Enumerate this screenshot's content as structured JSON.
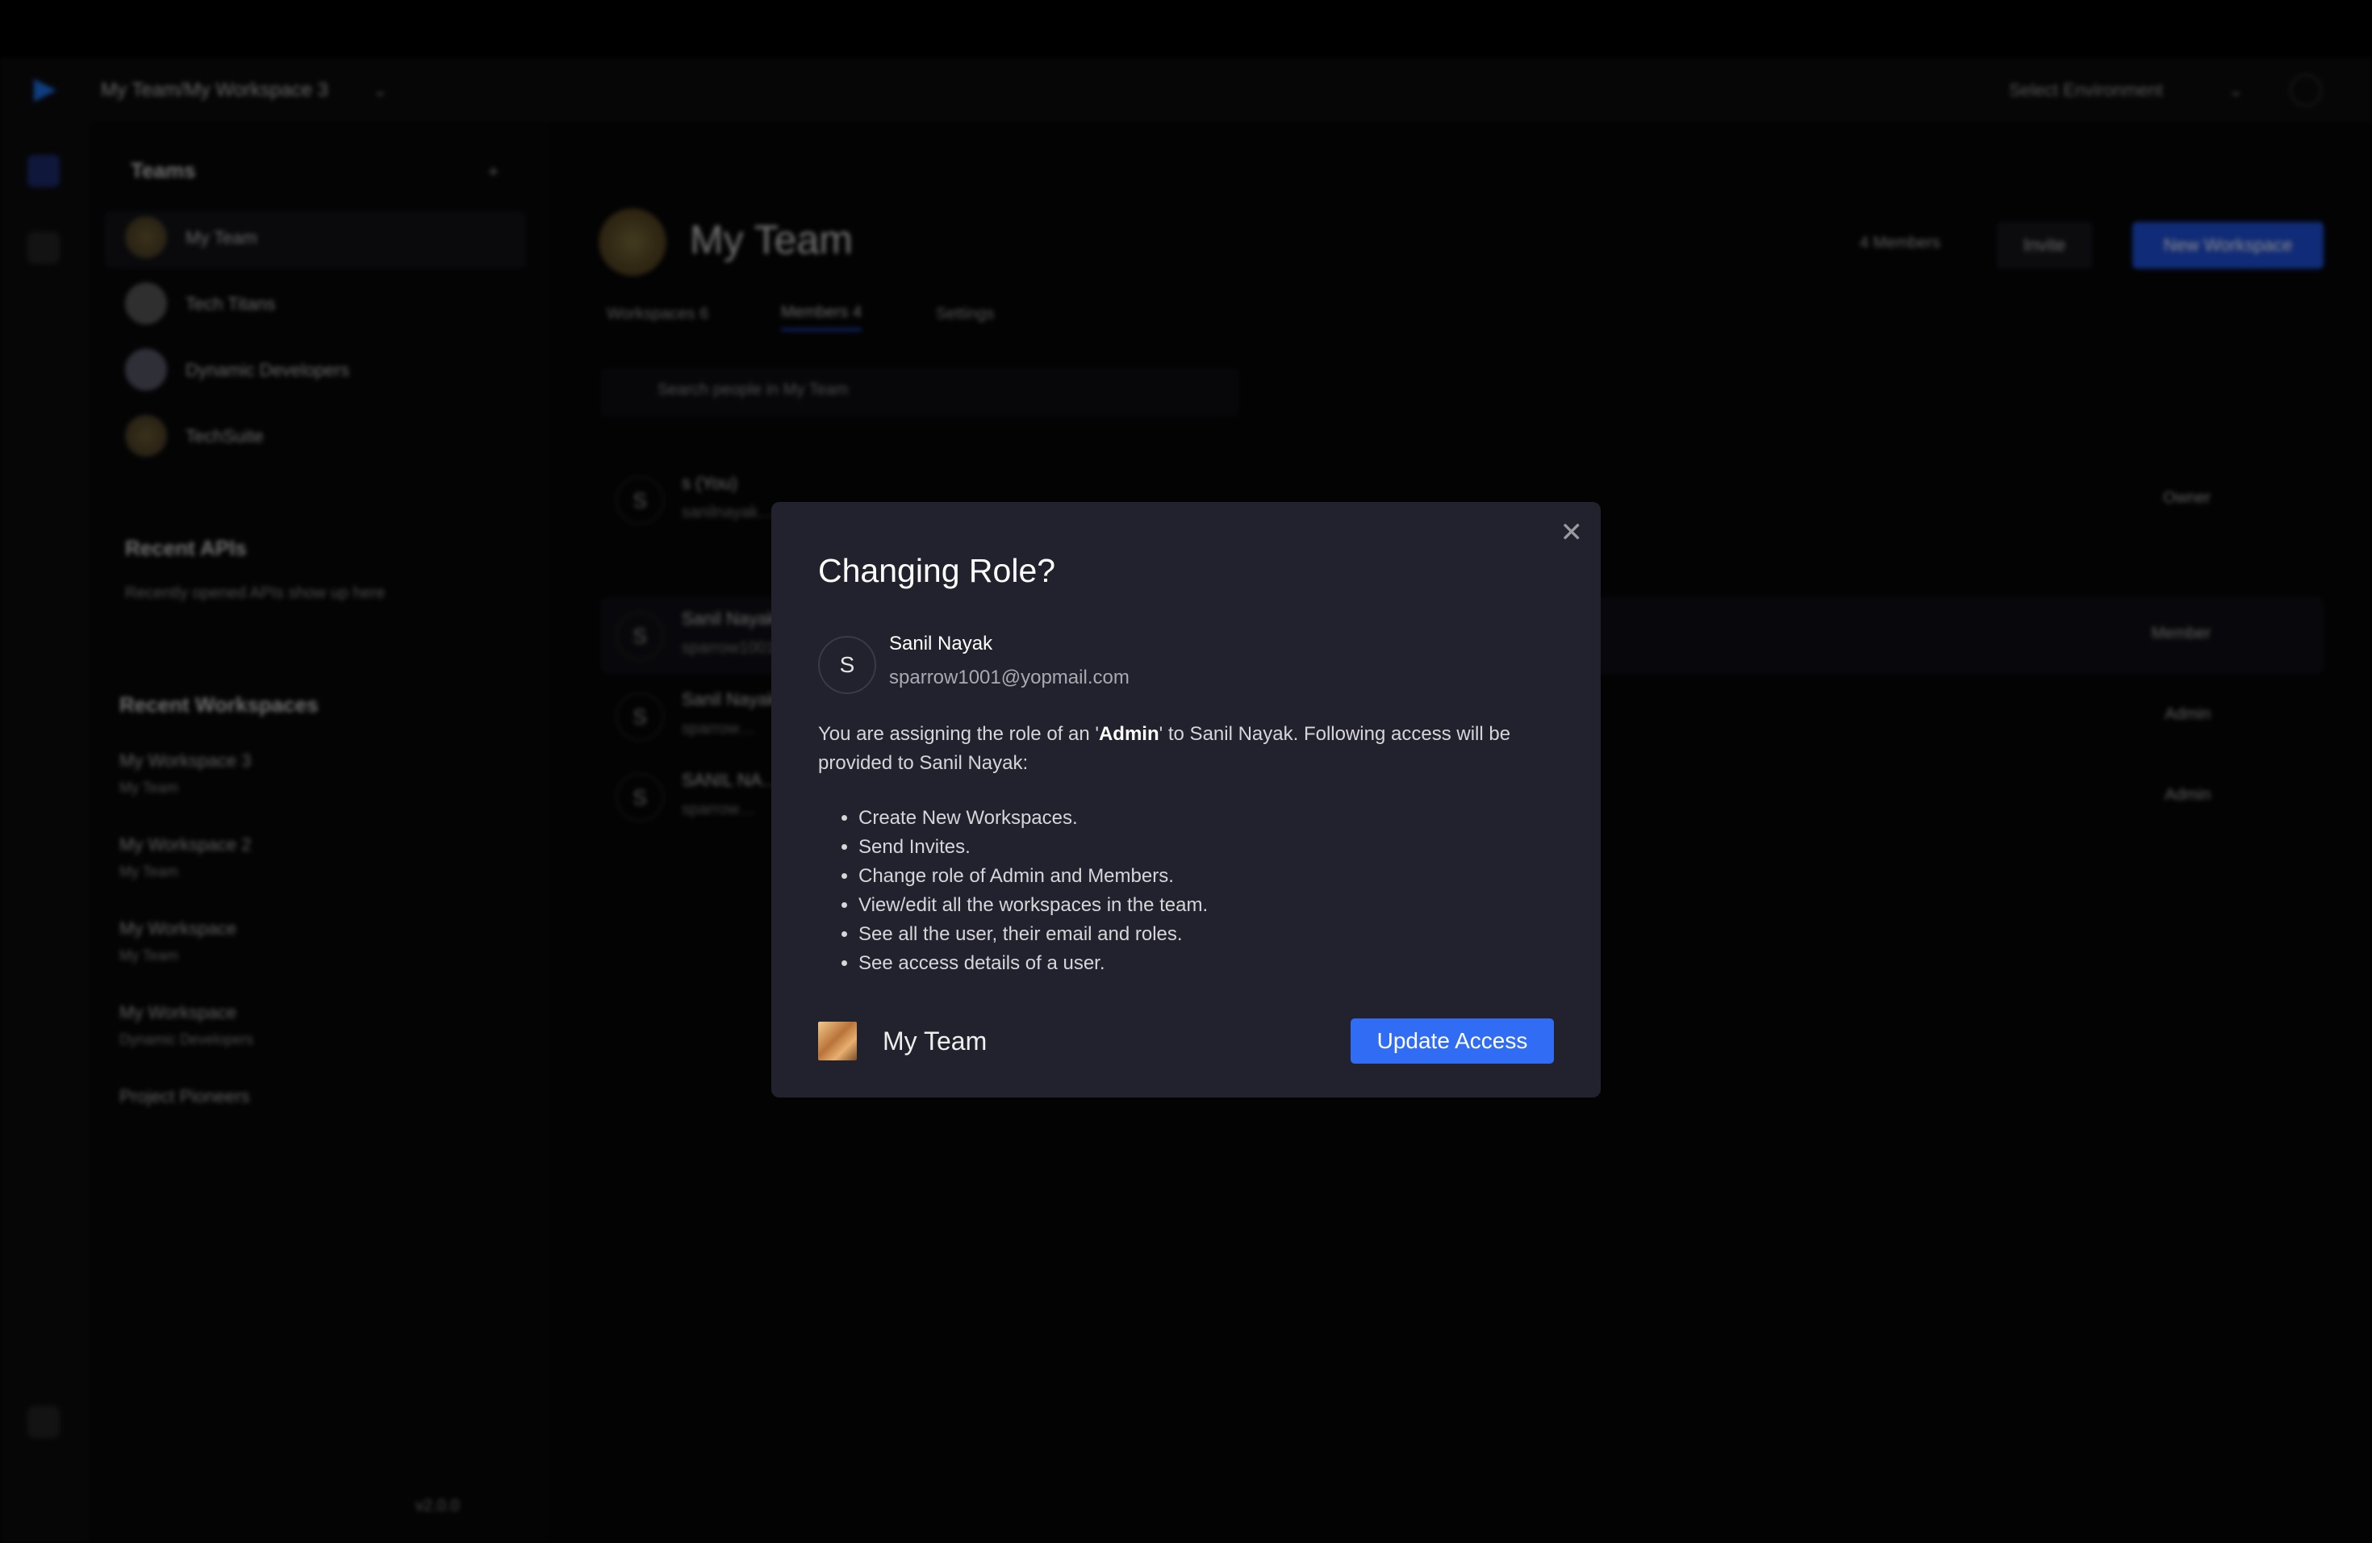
{
  "header": {
    "breadcrumb": "My Team/My Workspace 3",
    "environment": "Select Environment"
  },
  "sidebar": {
    "teams_heading": "Teams",
    "teams": [
      {
        "label": "My Team"
      },
      {
        "label": "Tech Titans"
      },
      {
        "label": "Dynamic Developers"
      },
      {
        "label": "TechSuite"
      }
    ],
    "recent_apis_heading": "Recent APIs",
    "recent_apis_empty": "Recently opened APIs show up here",
    "recent_workspaces_heading": "Recent Workspaces",
    "recent_workspaces": [
      {
        "name": "My Workspace 3",
        "team": "My Team"
      },
      {
        "name": "My Workspace 2",
        "team": "My Team"
      },
      {
        "name": "My Workspace",
        "team": "My Team"
      },
      {
        "name": "My Workspace",
        "team": "Dynamic Developers"
      }
    ],
    "extra_team": "Project Pioneers",
    "version": "v2.0.0"
  },
  "main": {
    "title": "My Team",
    "members_count": "4 Members",
    "invite_label": "Invite",
    "new_workspace_label": "New Workspace",
    "tabs": [
      {
        "label": "Workspaces",
        "count": "6"
      },
      {
        "label": "Members",
        "count": "4"
      },
      {
        "label": "Settings"
      }
    ],
    "search_placeholder": "Search people in My Team",
    "members": [
      {
        "initial": "S",
        "name": "s (You)",
        "email": "sanilnayak…",
        "role": "Owner"
      },
      {
        "initial": "S",
        "name": "Sanil Nayak",
        "email": "sparrow1001@yopmail.com",
        "role": "Member"
      },
      {
        "initial": "S",
        "name": "Sanil Nayak",
        "email": "sparrow…",
        "role": "Admin"
      },
      {
        "initial": "S",
        "name": "SANIL NA…",
        "email": "sparrow…",
        "role": "Admin"
      }
    ]
  },
  "modal": {
    "title": "Changing Role?",
    "user": {
      "initial": "S",
      "name": "Sanil Nayak",
      "email": "sparrow1001@yopmail.com"
    },
    "desc_pre": "You are assigning the role of an '",
    "desc_role": "Admin",
    "desc_post": "' to Sanil Nayak. Following access will be provided to Sanil Nayak:",
    "permissions": [
      "Create New Workspaces.",
      "Send Invites.",
      "Change role of Admin and Members.",
      "View/edit all the workspaces in the team.",
      "See all the user, their email and roles.",
      "See access details of a user."
    ],
    "team_name": "My Team",
    "update_label": "Update Access",
    "close_icon": "close-icon"
  },
  "colors": {
    "modal_bg": "#22222e",
    "primary": "#316cf4"
  }
}
